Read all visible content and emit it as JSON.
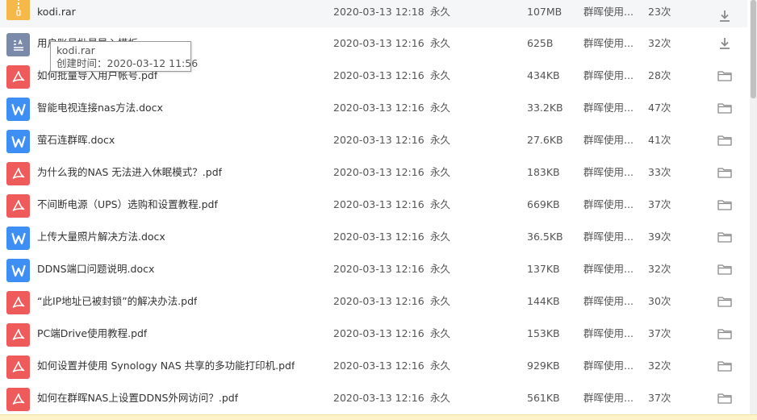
{
  "colors": {
    "pdf": "#ef5a5a",
    "word": "#3d8ff5",
    "rar": "#f7b84a",
    "txt": "#7a8aa8",
    "action_icon": "#8a8a8a"
  },
  "tooltip": {
    "title": "kodi.rar",
    "created": "创建时间：2020-03-12 11:56"
  },
  "files": [
    {
      "type": "rar",
      "name": "kodi.rar",
      "date": "2020-03-13 12:18",
      "expiry": "永久",
      "size": "107MB",
      "source": "群晖使用...",
      "count": "23次",
      "action": "download-icon"
    },
    {
      "type": "txt",
      "name": "用户账号批量导入模板",
      "date": "2020-03-13 12:16",
      "expiry": "永久",
      "size": "625B",
      "source": "群晖使用...",
      "count": "32次",
      "action": "download-icon"
    },
    {
      "type": "pdf",
      "name": "如何批量导入用户帐号.pdf",
      "date": "2020-03-13 12:16",
      "expiry": "永久",
      "size": "434KB",
      "source": "群晖使用...",
      "count": "28次",
      "action": "folder-icon"
    },
    {
      "type": "word",
      "name": "智能电视连接nas方法.docx",
      "date": "2020-03-13 12:16",
      "expiry": "永久",
      "size": "33.2KB",
      "source": "群晖使用...",
      "count": "47次",
      "action": "folder-icon"
    },
    {
      "type": "word",
      "name": "萤石连群晖.docx",
      "date": "2020-03-13 12:16",
      "expiry": "永久",
      "size": "27.6KB",
      "source": "群晖使用...",
      "count": "41次",
      "action": "folder-icon"
    },
    {
      "type": "pdf",
      "name": "为什么我的NAS 无法进入休眠模式？.pdf",
      "date": "2020-03-13 12:16",
      "expiry": "永久",
      "size": "183KB",
      "source": "群晖使用...",
      "count": "33次",
      "action": "folder-icon"
    },
    {
      "type": "pdf",
      "name": "不间断电源（UPS）选购和设置教程.pdf",
      "date": "2020-03-13 12:16",
      "expiry": "永久",
      "size": "669KB",
      "source": "群晖使用...",
      "count": "37次",
      "action": "folder-icon"
    },
    {
      "type": "word",
      "name": "上传大量照片解决方法.docx",
      "date": "2020-03-13 12:16",
      "expiry": "永久",
      "size": "36.5KB",
      "source": "群晖使用...",
      "count": "39次",
      "action": "folder-icon"
    },
    {
      "type": "word",
      "name": "DDNS端口问题说明.docx",
      "date": "2020-03-13 12:16",
      "expiry": "永久",
      "size": "137KB",
      "source": "群晖使用...",
      "count": "32次",
      "action": "folder-icon"
    },
    {
      "type": "pdf",
      "name": "“此IP地址已被封锁”的解决办法.pdf",
      "date": "2020-03-13 12:16",
      "expiry": "永久",
      "size": "144KB",
      "source": "群晖使用...",
      "count": "30次",
      "action": "folder-icon"
    },
    {
      "type": "pdf",
      "name": "PC端Drive使用教程.pdf",
      "date": "2020-03-13 12:16",
      "expiry": "永久",
      "size": "153KB",
      "source": "群晖使用...",
      "count": "37次",
      "action": "folder-icon"
    },
    {
      "type": "pdf",
      "name": "如何设置并使用 Synology NAS 共享的多功能打印机.pdf",
      "date": "2020-03-13 12:16",
      "expiry": "永久",
      "size": "929KB",
      "source": "群晖使用...",
      "count": "32次",
      "action": "folder-icon"
    },
    {
      "type": "pdf",
      "name": "如何在群晖NAS上设置DDNS外网访问？.pdf",
      "date": "2020-03-13 12:16",
      "expiry": "永久",
      "size": "561KB",
      "source": "群晖使用...",
      "count": "37次",
      "action": "folder-icon"
    }
  ]
}
